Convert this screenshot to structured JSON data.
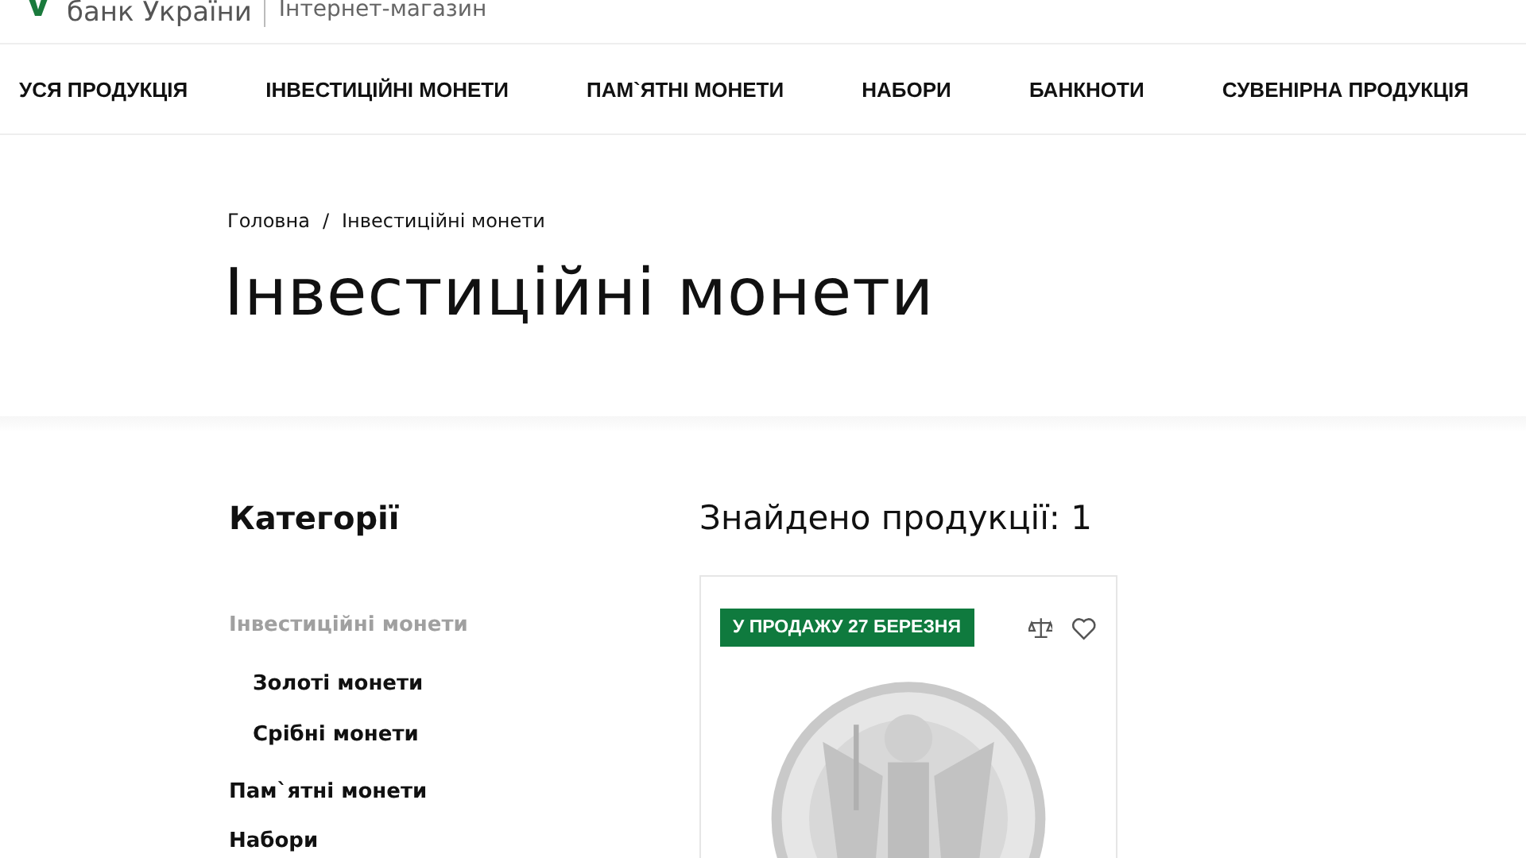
{
  "header": {
    "logo_text": "банк України",
    "subtitle": "Інтернет-магазин"
  },
  "nav": [
    {
      "label": "УСЯ ПРОДУКЦІЯ"
    },
    {
      "label": "ІНВЕСТИЦІЙНІ МОНЕТИ"
    },
    {
      "label": "ПАМ`ЯТНІ МОНЕТИ"
    },
    {
      "label": "НАБОРИ"
    },
    {
      "label": "БАНКНОТИ"
    },
    {
      "label": "СУВЕНІРНА ПРОДУКЦІЯ"
    }
  ],
  "breadcrumb": [
    "Головна",
    "Інвестиційні монети"
  ],
  "breadcrumb_separator": "/",
  "page_title": "Інвестиційні монети",
  "sidebar": {
    "title": "Категорії",
    "items": [
      {
        "label": "Інвестиційні монети",
        "selected": true,
        "children": [
          {
            "label": "Золоті монети",
            "selected": false
          },
          {
            "label": "Срібні монети",
            "selected": false
          }
        ]
      },
      {
        "label": "Пам`ятні монети",
        "selected": false
      },
      {
        "label": "Набори",
        "selected": false
      }
    ]
  },
  "results": {
    "count_text": "Знайдено продукції: 1",
    "products": [
      {
        "badge": "У ПРОДАЖУ 27 БЕРЕЗНЯ"
      }
    ]
  }
}
